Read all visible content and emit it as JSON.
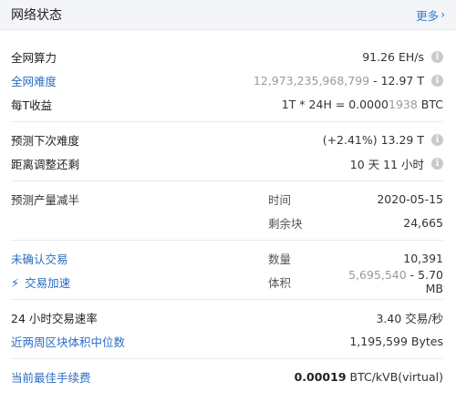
{
  "header": {
    "title": "网络状态",
    "more": "更多"
  },
  "hashrate": {
    "label": "全网算力",
    "value": "91.26 EH/s"
  },
  "difficulty": {
    "label": "全网难度",
    "raw": "12,973,235,968,799",
    "sep": " - ",
    "short": "12.97 T"
  },
  "per_t_income": {
    "label": "每T收益",
    "prefix": "1T * 24H = 0.0000",
    "muted": "1938",
    "unit": " BTC"
  },
  "next_difficulty": {
    "label": "预测下次难度",
    "value": "(+2.41%) 13.29 T"
  },
  "adjust_remaining": {
    "label": "距离调整还剩",
    "value": "10 天 11 小时"
  },
  "halving": {
    "label": "预测产量减半",
    "time_label": "时间",
    "time_value": "2020-05-15",
    "blocks_label": "剩余块",
    "blocks_value": "24,665"
  },
  "unconfirmed": {
    "label": "未确认交易",
    "count_label": "数量",
    "count_value": "10,391"
  },
  "accelerate": {
    "label": "交易加速",
    "size_label": "体积",
    "size_raw": "5,695,540",
    "sep": " - ",
    "size_short": "5.70 MB"
  },
  "tx_rate": {
    "label": "24 小时交易速率",
    "value": "3.40 交易/秒"
  },
  "median_block": {
    "label": "近两周区块体积中位数",
    "value": "1,195,599 Bytes"
  },
  "best_fee": {
    "label": "当前最佳手续费",
    "value_bold": "0.00019",
    "unit": " BTC/kVB(virtual)"
  },
  "icons": {
    "info": "info-icon",
    "more": "chevron-right-icon",
    "bolt": "lightning-icon"
  },
  "colors": {
    "link": "#2b6cc4",
    "header_bg": "#f3f5f8",
    "muted": "#9a9a9a"
  }
}
